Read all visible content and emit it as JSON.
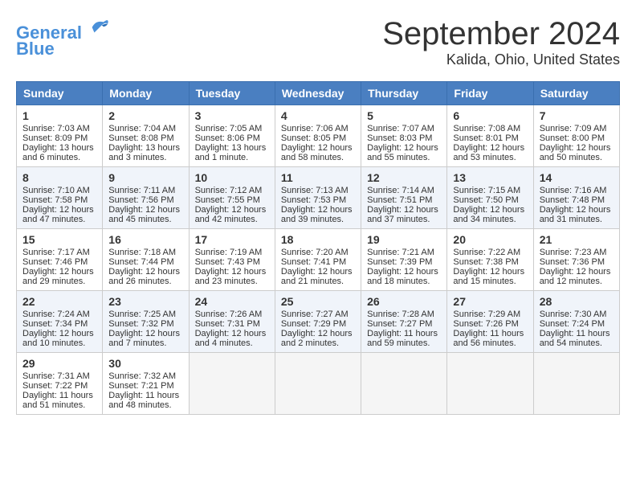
{
  "header": {
    "logo_line1": "General",
    "logo_line2": "Blue",
    "month_title": "September 2024",
    "location": "Kalida, Ohio, United States"
  },
  "weekdays": [
    "Sunday",
    "Monday",
    "Tuesday",
    "Wednesday",
    "Thursday",
    "Friday",
    "Saturday"
  ],
  "weeks": [
    [
      {
        "day": "1",
        "sunrise": "7:03 AM",
        "sunset": "8:09 PM",
        "daylight": "13 hours and 6 minutes."
      },
      {
        "day": "2",
        "sunrise": "7:04 AM",
        "sunset": "8:08 PM",
        "daylight": "13 hours and 3 minutes."
      },
      {
        "day": "3",
        "sunrise": "7:05 AM",
        "sunset": "8:06 PM",
        "daylight": "13 hours and 1 minute."
      },
      {
        "day": "4",
        "sunrise": "7:06 AM",
        "sunset": "8:05 PM",
        "daylight": "12 hours and 58 minutes."
      },
      {
        "day": "5",
        "sunrise": "7:07 AM",
        "sunset": "8:03 PM",
        "daylight": "12 hours and 55 minutes."
      },
      {
        "day": "6",
        "sunrise": "7:08 AM",
        "sunset": "8:01 PM",
        "daylight": "12 hours and 53 minutes."
      },
      {
        "day": "7",
        "sunrise": "7:09 AM",
        "sunset": "8:00 PM",
        "daylight": "12 hours and 50 minutes."
      }
    ],
    [
      {
        "day": "8",
        "sunrise": "7:10 AM",
        "sunset": "7:58 PM",
        "daylight": "12 hours and 47 minutes."
      },
      {
        "day": "9",
        "sunrise": "7:11 AM",
        "sunset": "7:56 PM",
        "daylight": "12 hours and 45 minutes."
      },
      {
        "day": "10",
        "sunrise": "7:12 AM",
        "sunset": "7:55 PM",
        "daylight": "12 hours and 42 minutes."
      },
      {
        "day": "11",
        "sunrise": "7:13 AM",
        "sunset": "7:53 PM",
        "daylight": "12 hours and 39 minutes."
      },
      {
        "day": "12",
        "sunrise": "7:14 AM",
        "sunset": "7:51 PM",
        "daylight": "12 hours and 37 minutes."
      },
      {
        "day": "13",
        "sunrise": "7:15 AM",
        "sunset": "7:50 PM",
        "daylight": "12 hours and 34 minutes."
      },
      {
        "day": "14",
        "sunrise": "7:16 AM",
        "sunset": "7:48 PM",
        "daylight": "12 hours and 31 minutes."
      }
    ],
    [
      {
        "day": "15",
        "sunrise": "7:17 AM",
        "sunset": "7:46 PM",
        "daylight": "12 hours and 29 minutes."
      },
      {
        "day": "16",
        "sunrise": "7:18 AM",
        "sunset": "7:44 PM",
        "daylight": "12 hours and 26 minutes."
      },
      {
        "day": "17",
        "sunrise": "7:19 AM",
        "sunset": "7:43 PM",
        "daylight": "12 hours and 23 minutes."
      },
      {
        "day": "18",
        "sunrise": "7:20 AM",
        "sunset": "7:41 PM",
        "daylight": "12 hours and 21 minutes."
      },
      {
        "day": "19",
        "sunrise": "7:21 AM",
        "sunset": "7:39 PM",
        "daylight": "12 hours and 18 minutes."
      },
      {
        "day": "20",
        "sunrise": "7:22 AM",
        "sunset": "7:38 PM",
        "daylight": "12 hours and 15 minutes."
      },
      {
        "day": "21",
        "sunrise": "7:23 AM",
        "sunset": "7:36 PM",
        "daylight": "12 hours and 12 minutes."
      }
    ],
    [
      {
        "day": "22",
        "sunrise": "7:24 AM",
        "sunset": "7:34 PM",
        "daylight": "12 hours and 10 minutes."
      },
      {
        "day": "23",
        "sunrise": "7:25 AM",
        "sunset": "7:32 PM",
        "daylight": "12 hours and 7 minutes."
      },
      {
        "day": "24",
        "sunrise": "7:26 AM",
        "sunset": "7:31 PM",
        "daylight": "12 hours and 4 minutes."
      },
      {
        "day": "25",
        "sunrise": "7:27 AM",
        "sunset": "7:29 PM",
        "daylight": "12 hours and 2 minutes."
      },
      {
        "day": "26",
        "sunrise": "7:28 AM",
        "sunset": "7:27 PM",
        "daylight": "11 hours and 59 minutes."
      },
      {
        "day": "27",
        "sunrise": "7:29 AM",
        "sunset": "7:26 PM",
        "daylight": "11 hours and 56 minutes."
      },
      {
        "day": "28",
        "sunrise": "7:30 AM",
        "sunset": "7:24 PM",
        "daylight": "11 hours and 54 minutes."
      }
    ],
    [
      {
        "day": "29",
        "sunrise": "7:31 AM",
        "sunset": "7:22 PM",
        "daylight": "11 hours and 51 minutes."
      },
      {
        "day": "30",
        "sunrise": "7:32 AM",
        "sunset": "7:21 PM",
        "daylight": "11 hours and 48 minutes."
      },
      null,
      null,
      null,
      null,
      null
    ]
  ]
}
